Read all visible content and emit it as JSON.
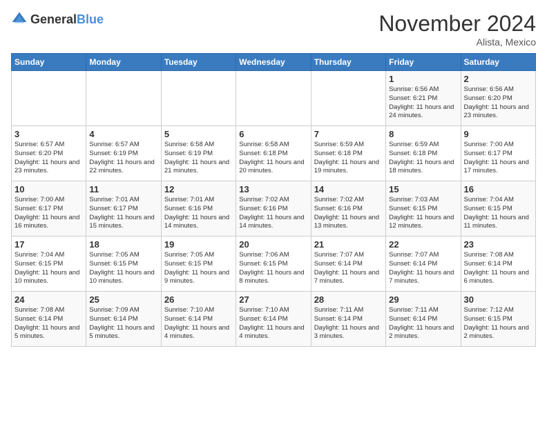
{
  "header": {
    "logo_general": "General",
    "logo_blue": "Blue",
    "month_title": "November 2024",
    "location": "Alista, Mexico"
  },
  "days_of_week": [
    "Sunday",
    "Monday",
    "Tuesday",
    "Wednesday",
    "Thursday",
    "Friday",
    "Saturday"
  ],
  "weeks": [
    [
      {
        "day": "",
        "info": ""
      },
      {
        "day": "",
        "info": ""
      },
      {
        "day": "",
        "info": ""
      },
      {
        "day": "",
        "info": ""
      },
      {
        "day": "",
        "info": ""
      },
      {
        "day": "1",
        "info": "Sunrise: 6:56 AM\nSunset: 6:21 PM\nDaylight: 11 hours and 24 minutes."
      },
      {
        "day": "2",
        "info": "Sunrise: 6:56 AM\nSunset: 6:20 PM\nDaylight: 11 hours and 23 minutes."
      }
    ],
    [
      {
        "day": "3",
        "info": "Sunrise: 6:57 AM\nSunset: 6:20 PM\nDaylight: 11 hours and 23 minutes."
      },
      {
        "day": "4",
        "info": "Sunrise: 6:57 AM\nSunset: 6:19 PM\nDaylight: 11 hours and 22 minutes."
      },
      {
        "day": "5",
        "info": "Sunrise: 6:58 AM\nSunset: 6:19 PM\nDaylight: 11 hours and 21 minutes."
      },
      {
        "day": "6",
        "info": "Sunrise: 6:58 AM\nSunset: 6:18 PM\nDaylight: 11 hours and 20 minutes."
      },
      {
        "day": "7",
        "info": "Sunrise: 6:59 AM\nSunset: 6:18 PM\nDaylight: 11 hours and 19 minutes."
      },
      {
        "day": "8",
        "info": "Sunrise: 6:59 AM\nSunset: 6:18 PM\nDaylight: 11 hours and 18 minutes."
      },
      {
        "day": "9",
        "info": "Sunrise: 7:00 AM\nSunset: 6:17 PM\nDaylight: 11 hours and 17 minutes."
      }
    ],
    [
      {
        "day": "10",
        "info": "Sunrise: 7:00 AM\nSunset: 6:17 PM\nDaylight: 11 hours and 16 minutes."
      },
      {
        "day": "11",
        "info": "Sunrise: 7:01 AM\nSunset: 6:17 PM\nDaylight: 11 hours and 15 minutes."
      },
      {
        "day": "12",
        "info": "Sunrise: 7:01 AM\nSunset: 6:16 PM\nDaylight: 11 hours and 14 minutes."
      },
      {
        "day": "13",
        "info": "Sunrise: 7:02 AM\nSunset: 6:16 PM\nDaylight: 11 hours and 14 minutes."
      },
      {
        "day": "14",
        "info": "Sunrise: 7:02 AM\nSunset: 6:16 PM\nDaylight: 11 hours and 13 minutes."
      },
      {
        "day": "15",
        "info": "Sunrise: 7:03 AM\nSunset: 6:15 PM\nDaylight: 11 hours and 12 minutes."
      },
      {
        "day": "16",
        "info": "Sunrise: 7:04 AM\nSunset: 6:15 PM\nDaylight: 11 hours and 11 minutes."
      }
    ],
    [
      {
        "day": "17",
        "info": "Sunrise: 7:04 AM\nSunset: 6:15 PM\nDaylight: 11 hours and 10 minutes."
      },
      {
        "day": "18",
        "info": "Sunrise: 7:05 AM\nSunset: 6:15 PM\nDaylight: 11 hours and 10 minutes."
      },
      {
        "day": "19",
        "info": "Sunrise: 7:05 AM\nSunset: 6:15 PM\nDaylight: 11 hours and 9 minutes."
      },
      {
        "day": "20",
        "info": "Sunrise: 7:06 AM\nSunset: 6:15 PM\nDaylight: 11 hours and 8 minutes."
      },
      {
        "day": "21",
        "info": "Sunrise: 7:07 AM\nSunset: 6:14 PM\nDaylight: 11 hours and 7 minutes."
      },
      {
        "day": "22",
        "info": "Sunrise: 7:07 AM\nSunset: 6:14 PM\nDaylight: 11 hours and 7 minutes."
      },
      {
        "day": "23",
        "info": "Sunrise: 7:08 AM\nSunset: 6:14 PM\nDaylight: 11 hours and 6 minutes."
      }
    ],
    [
      {
        "day": "24",
        "info": "Sunrise: 7:08 AM\nSunset: 6:14 PM\nDaylight: 11 hours and 5 minutes."
      },
      {
        "day": "25",
        "info": "Sunrise: 7:09 AM\nSunset: 6:14 PM\nDaylight: 11 hours and 5 minutes."
      },
      {
        "day": "26",
        "info": "Sunrise: 7:10 AM\nSunset: 6:14 PM\nDaylight: 11 hours and 4 minutes."
      },
      {
        "day": "27",
        "info": "Sunrise: 7:10 AM\nSunset: 6:14 PM\nDaylight: 11 hours and 4 minutes."
      },
      {
        "day": "28",
        "info": "Sunrise: 7:11 AM\nSunset: 6:14 PM\nDaylight: 11 hours and 3 minutes."
      },
      {
        "day": "29",
        "info": "Sunrise: 7:11 AM\nSunset: 6:14 PM\nDaylight: 11 hours and 2 minutes."
      },
      {
        "day": "30",
        "info": "Sunrise: 7:12 AM\nSunset: 6:15 PM\nDaylight: 11 hours and 2 minutes."
      }
    ]
  ]
}
